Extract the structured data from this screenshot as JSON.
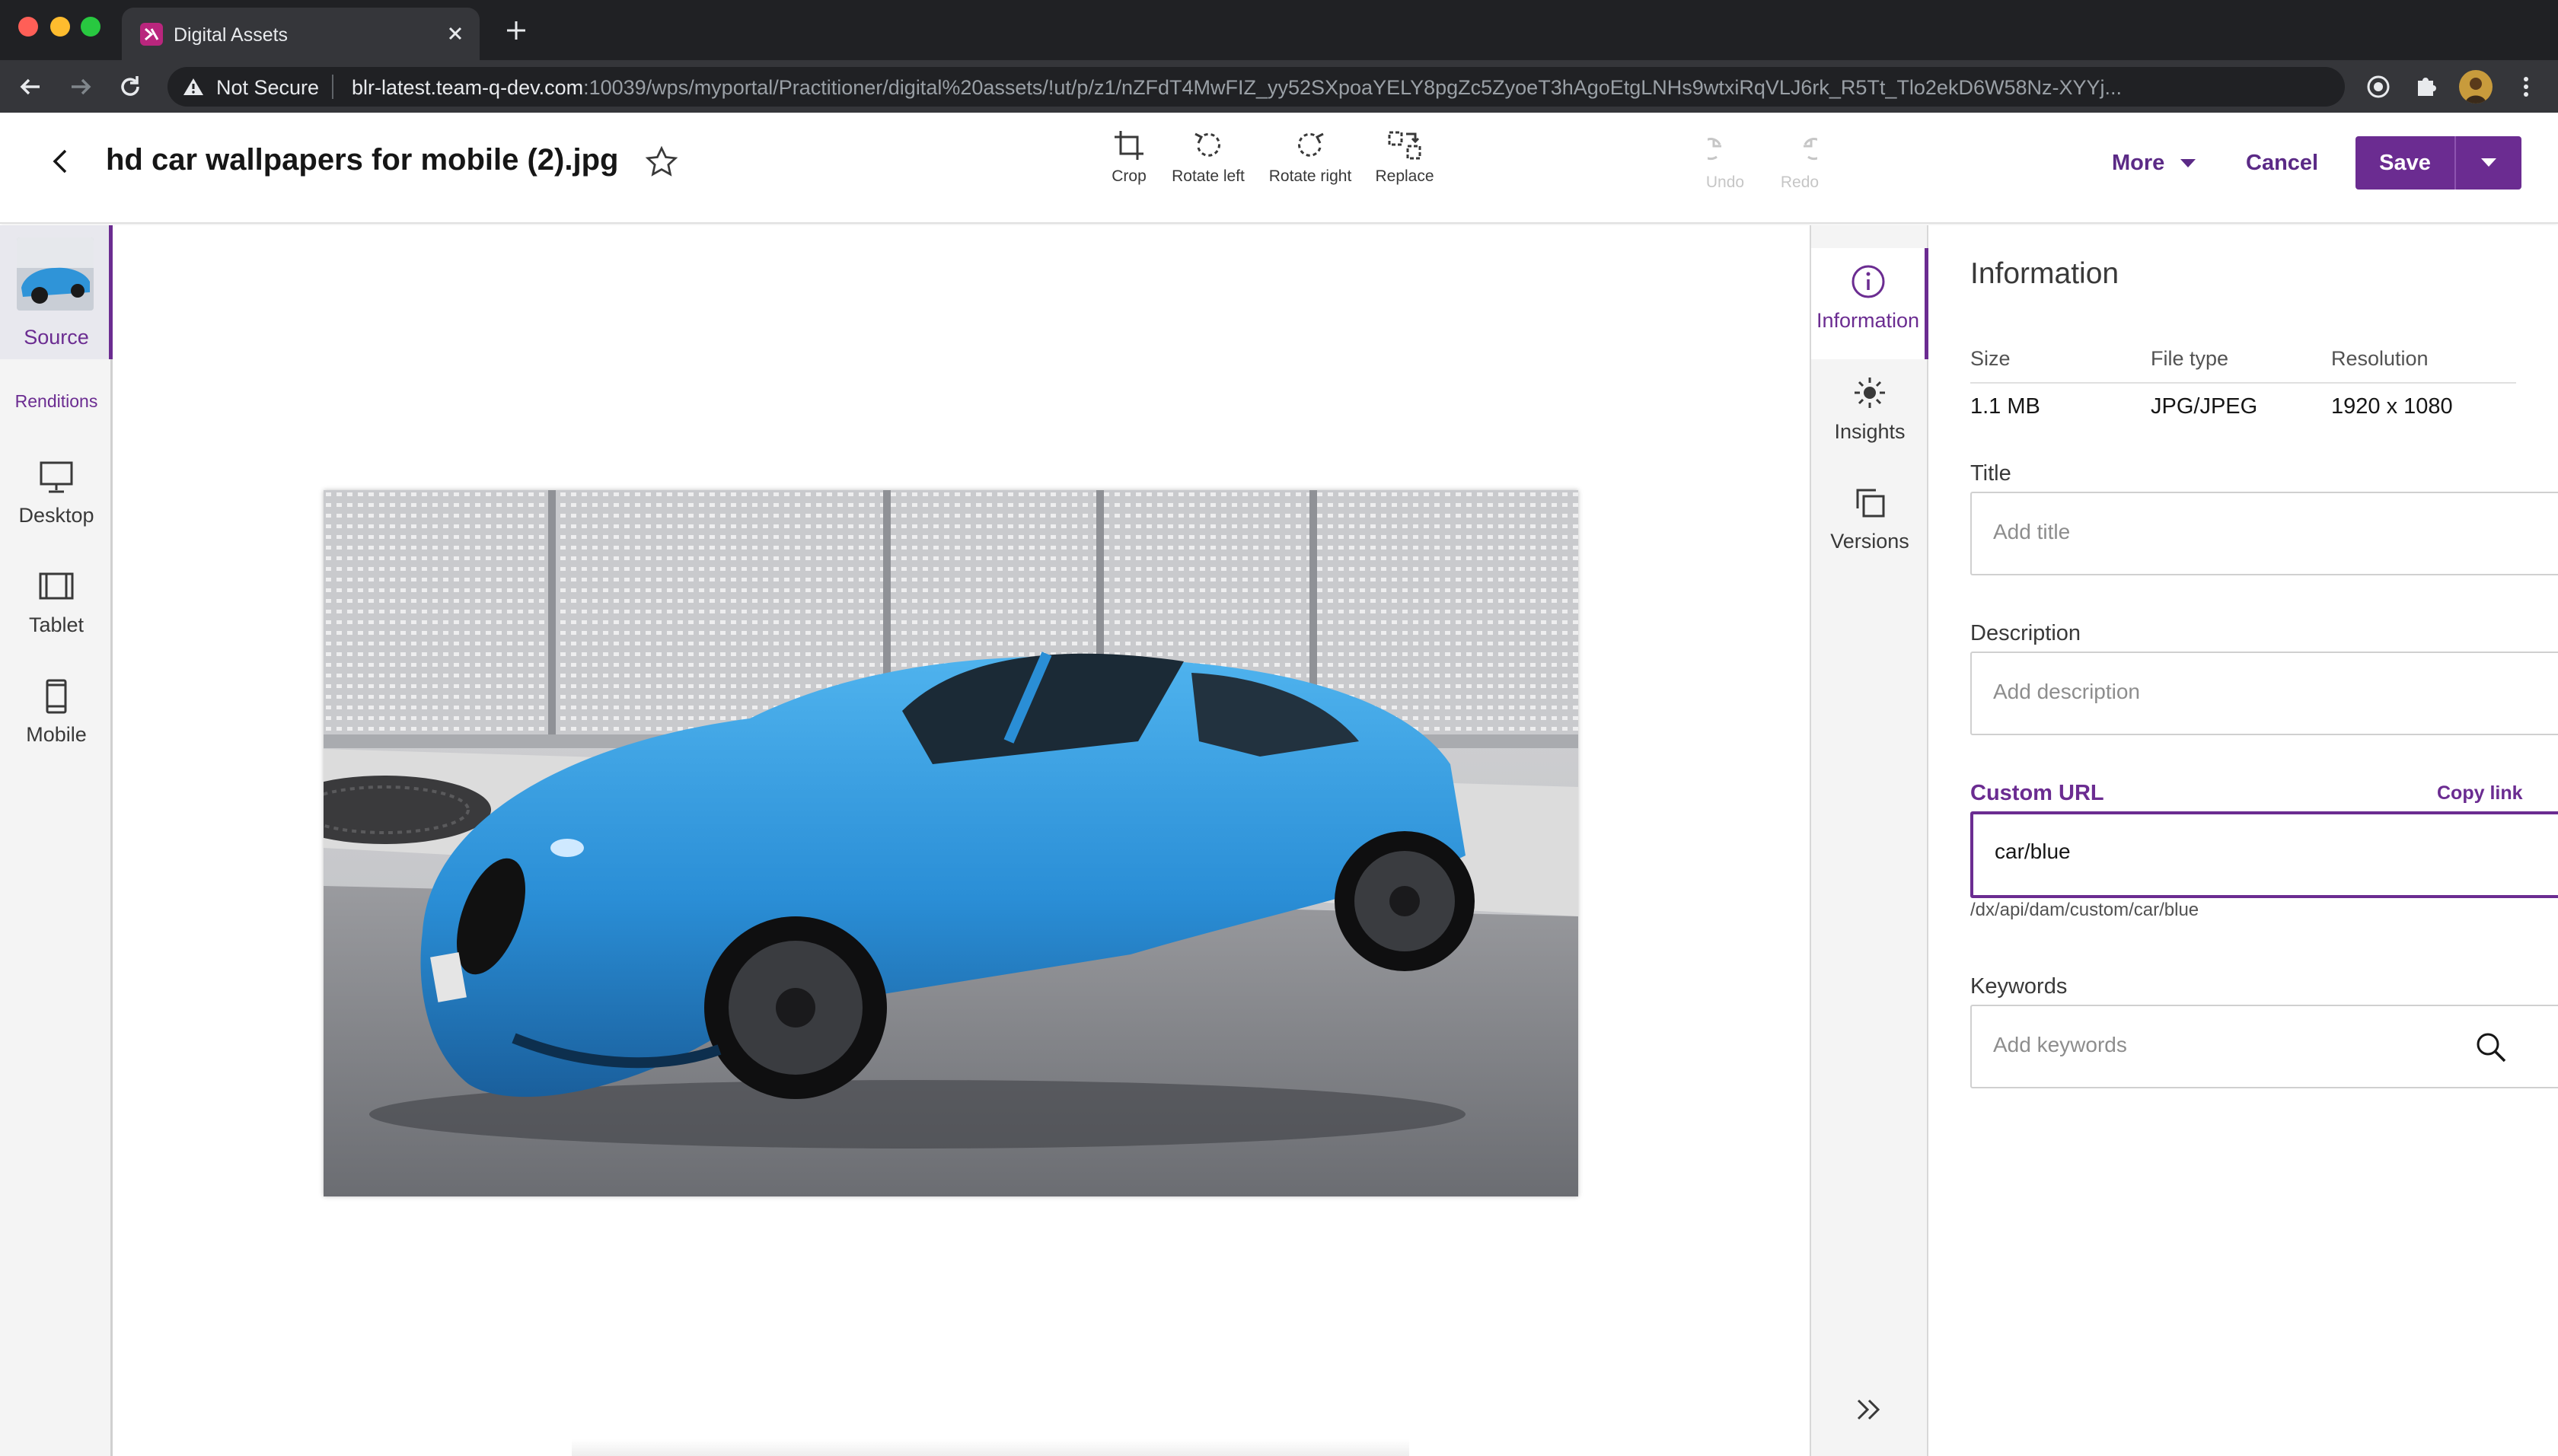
{
  "browser": {
    "tab_title": "Digital Assets",
    "security_label": "Not Secure",
    "url_host": "blr-latest.team-q-dev.com",
    "url_rest": ":10039/wps/myportal/Practitioner/digital%20assets/!ut/p/z1/nZFdT4MwFIZ_yy52SXpoaYELY8pgZc5ZyoeT3hAgoEtgLNHs9wtxiRqVLJ6rk_R5Tt_Tlo2ekD6W58Nz-XYYj..."
  },
  "header": {
    "asset_title": "hd car wallpapers for mobile (2).jpg",
    "tools": {
      "crop": "Crop",
      "rotate_left": "Rotate left",
      "rotate_right": "Rotate right",
      "replace": "Replace",
      "undo": "Undo",
      "redo": "Redo"
    },
    "more_label": "More",
    "cancel_label": "Cancel",
    "save_label": "Save"
  },
  "left_rail": {
    "source_label": "Source",
    "renditions_label": "Renditions",
    "renditions": [
      {
        "label": "Desktop",
        "icon": "monitor-icon"
      },
      {
        "label": "Tablet",
        "icon": "tablet-icon"
      },
      {
        "label": "Mobile",
        "icon": "mobile-icon"
      }
    ]
  },
  "panel_tabs": [
    {
      "label": "Information",
      "icon": "info-icon",
      "active": true
    },
    {
      "label": "Insights",
      "icon": "sun-icon",
      "active": false
    },
    {
      "label": "Versions",
      "icon": "versions-icon",
      "active": false
    }
  ],
  "info": {
    "title": "Information",
    "size_label": "Size",
    "size_value": "1.1 MB",
    "filetype_label": "File type",
    "filetype_value": "JPG/JPEG",
    "resolution_label": "Resolution",
    "resolution_value": "1920 x 1080",
    "title_field_label": "Title",
    "title_placeholder": "Add title",
    "description_label": "Description",
    "description_placeholder": "Add description",
    "custom_url_label": "Custom URL",
    "copy_link_label": "Copy link",
    "custom_url_value": "car/blue",
    "custom_url_hint": "/dx/api/dam/custom/car/blue",
    "keywords_label": "Keywords",
    "keywords_placeholder": "Add keywords"
  },
  "colors": {
    "accent": "#6b2c91",
    "chrome_dark": "#202124",
    "chrome_toolbar": "#35363a"
  }
}
